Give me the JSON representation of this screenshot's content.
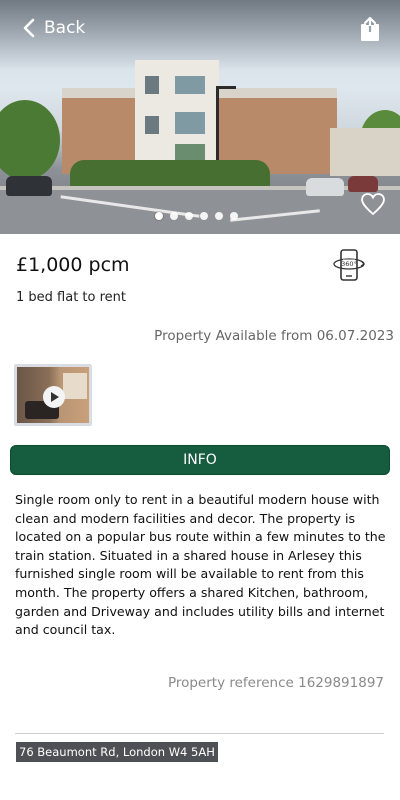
{
  "header": {
    "back_label": "Back",
    "back_icon": "chevron-left-icon",
    "share_icon": "share-icon",
    "favorite_icon": "heart-icon"
  },
  "gallery": {
    "slide_count": 6,
    "active_slide": 1
  },
  "listing": {
    "price": "£1,000 pcm",
    "type": "1 bed flat to rent",
    "tour_icon": "360-view-icon",
    "availability": "Property Available from 06.07.2023",
    "video_icon": "play-icon"
  },
  "info": {
    "button_label": "INFO",
    "button_color": "#165c3e",
    "description": "Single room only to rent in a beautiful modern house with clean and modern facilities and decor. The property is located on a popular bus route within a few minutes to the train station. Situated in a shared house in Arlesey this furnished single room will be available to rent from this month. The property offers a shared Kitchen, bathroom, garden and Driveway and includes utility bills and internet and council tax.",
    "reference": "Property reference 1629891897",
    "address": "76 Beaumont Rd, London W4 5AH"
  }
}
